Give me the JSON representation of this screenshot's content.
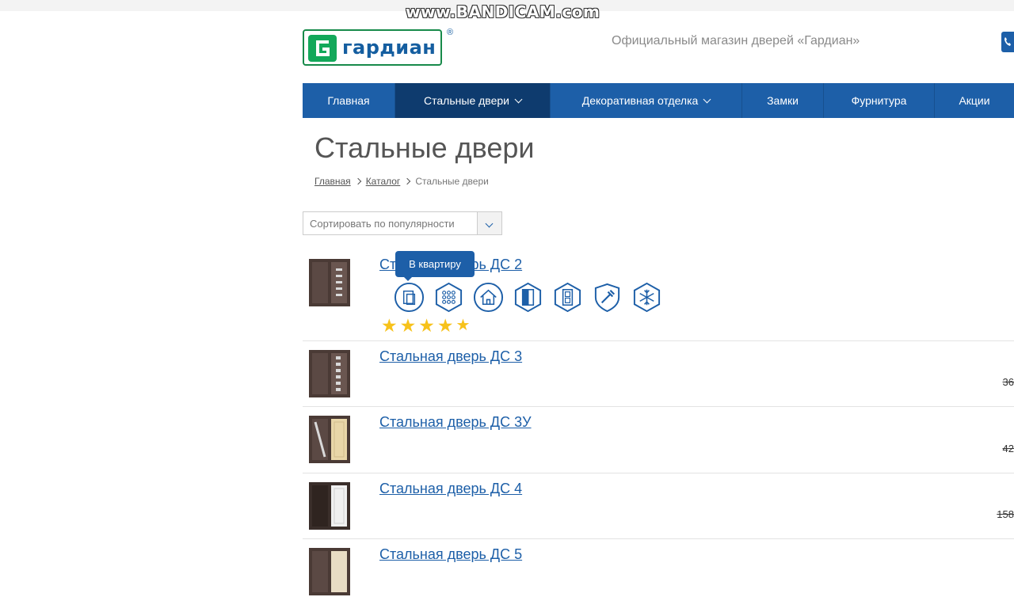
{
  "watermark": "www.BANDICAM.com",
  "header": {
    "logo_text": "гардиан",
    "logo_reg": "®",
    "tagline": "Официальный магазин дверей «Гардиан»"
  },
  "nav": [
    {
      "label": "Главная",
      "dropdown": false
    },
    {
      "label": "Стальные двери",
      "dropdown": true,
      "active": true
    },
    {
      "label": "Декоративная отделка",
      "dropdown": true
    },
    {
      "label": "Замки",
      "dropdown": false
    },
    {
      "label": "Фурнитура",
      "dropdown": false
    },
    {
      "label": "Акции",
      "dropdown": false
    }
  ],
  "page_title": "Стальные двери",
  "breadcrumb": [
    "Главная",
    "Каталог",
    "Стальные двери"
  ],
  "sort": {
    "label": "Сортировать по популярности"
  },
  "tooltip": "В квартиру",
  "features": [
    "apartment-icon",
    "panel-pattern-icon",
    "house-icon",
    "door-icon",
    "door-panel-icon",
    "shield-hammer-icon",
    "snowflake-icon"
  ],
  "rating": {
    "value": 5,
    "max": 5
  },
  "products": [
    {
      "title": "Стальная дверь ДС 2",
      "price": ""
    },
    {
      "title": "Стальная дверь ДС 3",
      "price": "36"
    },
    {
      "title": "Стальная дверь ДС 3У",
      "price": "42"
    },
    {
      "title": "Стальная дверь ДС 4",
      "price": "158"
    },
    {
      "title": "Стальная дверь ДС 5",
      "price": ""
    }
  ],
  "colors": {
    "brand_blue": "#1d5fa8",
    "nav_active": "#0e3b6e",
    "star": "#f7c21b",
    "logo_green": "#13a85a"
  }
}
